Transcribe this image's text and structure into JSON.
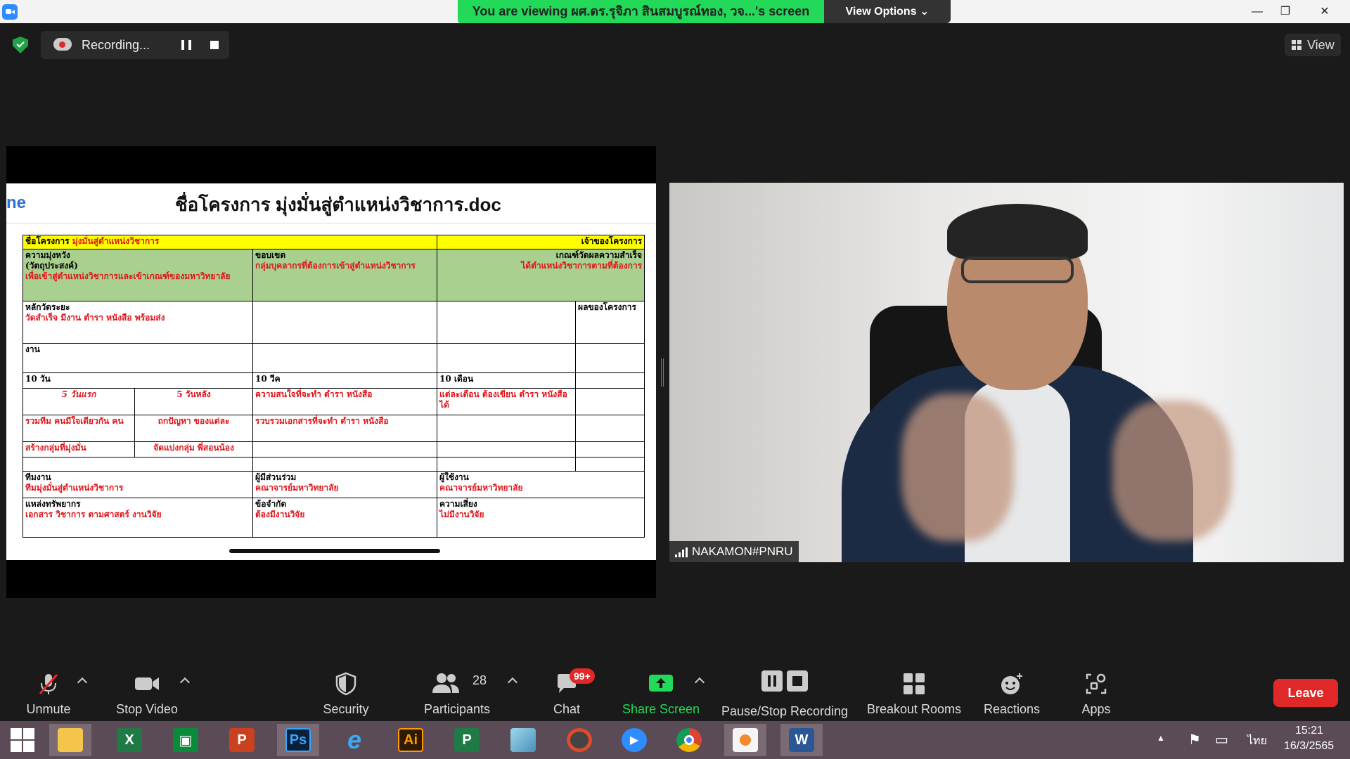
{
  "titlebar": {
    "banner": "You are viewing ผศ.ดร.รุจิภา สินสมบูรณ์ทอง, วจ...'s screen",
    "view_options": "View Options",
    "minimize": "—",
    "restore": "❐",
    "close": "✕"
  },
  "recording": {
    "status": "Recording...",
    "view": "View"
  },
  "doc": {
    "left_fragment": "ne",
    "title": "ชื่อโครงการ มุ่งมั่นสู่ตำแหน่งวิชาการ.doc",
    "r1_label": "ชื่อโครงการ",
    "r1_value": "มุ่งมั่นสู่ตำแหน่งวิชาการ",
    "r1_owner": "เจ้าของโครงการ",
    "r2_c1_head": "ความมุ่งหวัง",
    "r2_c1_sub": "(วัตถุประสงค์)",
    "r2_c1_val": "เพื่อเข้าสู่ตำแหน่งวิชาการและเข้าเกณฑ์ของมหาวิทยาลัย",
    "r2_c2_head": "ขอบเขต",
    "r2_c2_val": "กลุ่มบุคลากรที่ต้องการเข้าสู่ตำแหน่งวิชาการ",
    "r2_c3_head": "เกณฑ์วัดผลความสำเร็จ",
    "r2_c3_val": "ได้ตำแหน่งวิชาการตามที่ต้องการ",
    "r3_c1_head": "หลักวัดระยะ",
    "r3_c1_val": "วัดสำเร็จ มีงาน ตำรา หนังสือ พร้อมส่ง",
    "r3_c5": "ผลของโครงการ",
    "r4_c1": "งาน",
    "r5_c1": "10 วัน",
    "r5_c3": "10 วีค",
    "r5_c4": "10 เดือน",
    "r6_c1": "5 วันแรก",
    "r6_c2": "5 วันหลัง",
    "r6_c3": "ความสนใจที่จะทำ ตำรา หนังสือ",
    "r6_c4": "แต่ละเดือน ต้องเขียน ตำรา หนังสือ ได้",
    "r7_c1": "รวมทีม คนมีใจเดียวกัน คน",
    "r7_c2": "ถกปัญหา ของแต่ละ",
    "r7_c3": "รวบรวมเอกสารที่จะทำ ตำรา หนังสือ",
    "r8_c1": "สร้างกลุ่มที่มุ่งมั่น",
    "r8_c2": "จัดแบ่งกลุ่ม พี่สอนน้อง",
    "r10_c1_head": "ทีมงาน",
    "r10_c1_val": "ทีมมุ่งมั่นสู่ตำแหน่งวิชาการ",
    "r10_c2_head": "ผู้มีส่วนร่วม",
    "r10_c2_val": "คณาจารย์มหาวิทยาลัย",
    "r10_c3_head": "ผู้ใช้งาน",
    "r10_c3_val": "คณาจารย์มหาวิทยาลัย",
    "r11_c1_head": "แหล่งทรัพยากร",
    "r11_c1_val": "เอกสาร วิชาการ ตามศาสตร์ งานวิจัย",
    "r11_c2_head": "ข้อจำกัด",
    "r11_c2_val": "ต้องมีงานวิจัย",
    "r11_c3_head": "ความเสี่ยง",
    "r11_c3_val": "ไม่มีงานวิจัย"
  },
  "video": {
    "participant_name": "NAKAMON#PNRU"
  },
  "toolbar": {
    "unmute": "Unmute",
    "stop_video": "Stop Video",
    "security": "Security",
    "participants": "Participants",
    "participants_count": "28",
    "chat": "Chat",
    "chat_badge": "99+",
    "share_screen": "Share Screen",
    "pause_stop_recording": "Pause/Stop Recording",
    "breakout_rooms": "Breakout Rooms",
    "reactions": "Reactions",
    "apps": "Apps",
    "leave": "Leave"
  },
  "taskbar": {
    "apps": [
      "Windows Start",
      "File Explorer",
      "Excel",
      "Publisher",
      "PowerPoint",
      "Photoshop",
      "Internet Explorer",
      "Illustrator",
      "Project",
      "Paint",
      "PhotoScape",
      "Zoom",
      "Chrome",
      "Paint 3D",
      "Word"
    ],
    "ps_label": "Ps",
    "ai_label": "Ai",
    "lang": "ไทย",
    "time": "15:21",
    "date": "16/3/2565"
  },
  "colors": {
    "banner_green": "#23d959",
    "share_green": "#23d959",
    "leave_red": "#e02828",
    "doc_red": "#e0151b",
    "doc_yellow": "#ffff00",
    "doc_green": "#a9d08e"
  }
}
